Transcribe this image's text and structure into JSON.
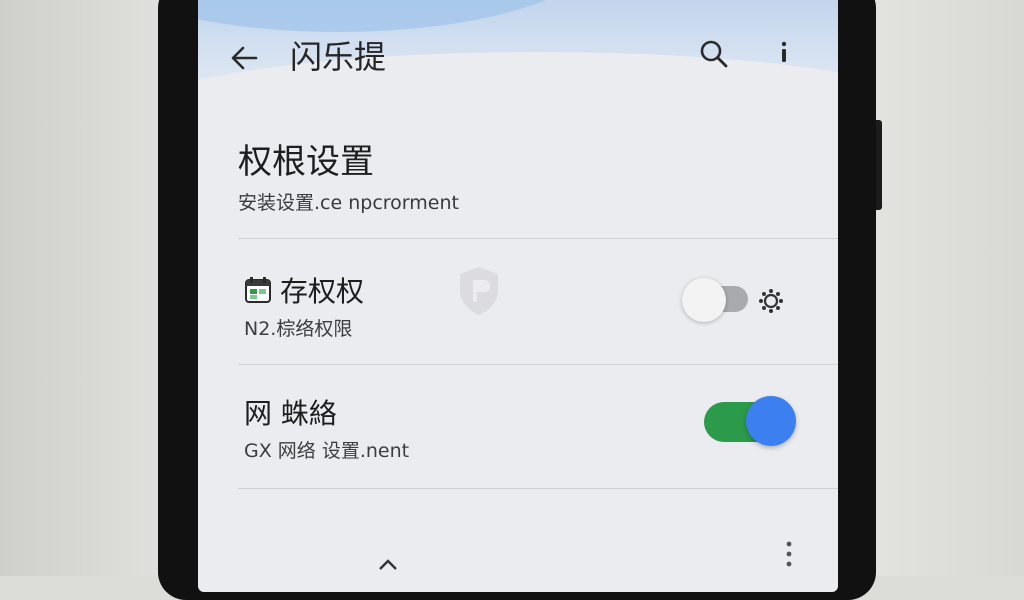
{
  "header": {
    "title": "闪乐提",
    "back_icon": "arrow-left-icon",
    "search_icon": "search-icon",
    "more_icon": "more-vertical-icon"
  },
  "section": {
    "title": "权根设置",
    "subtitle": "安装设置.ce npcrorment"
  },
  "rows": [
    {
      "icon": "calendar-icon",
      "title": "存权权",
      "subtitle": "N2.棕络权限",
      "toggle_on": false,
      "extra_icon": "gear-icon"
    },
    {
      "title": "网 蛛絡",
      "subtitle": "GX 网络 设置.nent",
      "toggle_on": true
    }
  ],
  "colors": {
    "accent_blue": "#3b7ff0",
    "toggle_green": "#2b9a4a",
    "header_blue": "#bfd3ec"
  }
}
